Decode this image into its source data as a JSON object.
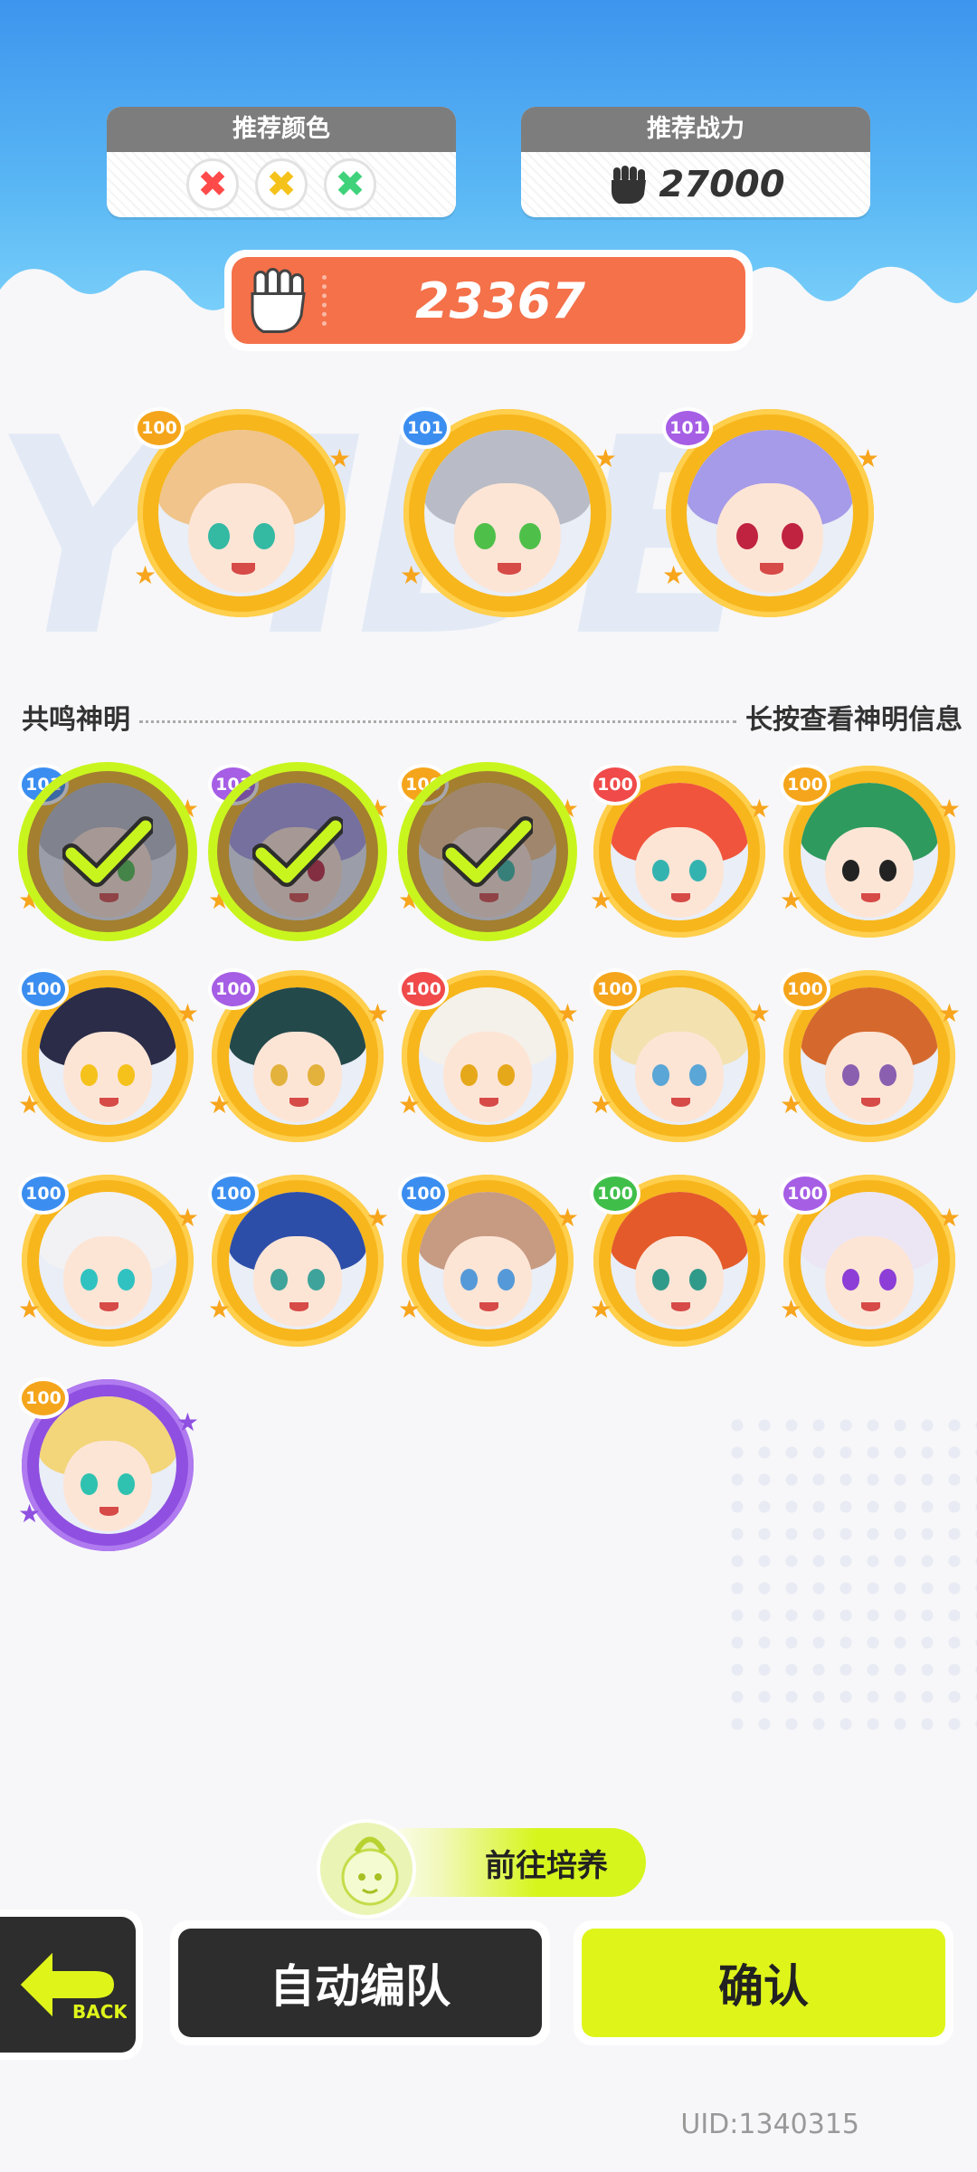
{
  "recommend": {
    "color_title": "推荐颜色",
    "colors": [
      {
        "name": "red",
        "hex": "#ff4a4a"
      },
      {
        "name": "yellow",
        "hex": "#f5c21b"
      },
      {
        "name": "green",
        "hex": "#3fd27a"
      }
    ],
    "power_title": "推荐战力",
    "power_value": "27000"
  },
  "team_power": "23367",
  "selected": [
    {
      "level": "100",
      "level_color": "#f5a51b",
      "hair": "#f0c48a",
      "eye": "#34b9a3"
    },
    {
      "level": "101",
      "level_color": "#3b8ef0",
      "hair": "#b9bcc6",
      "eye": "#4ec04a"
    },
    {
      "level": "101",
      "level_color": "#a65ee5",
      "hair": "#a69be8",
      "eye": "#c0233f"
    }
  ],
  "section": {
    "left_label": "共鸣神明",
    "right_label": "长按查看神明信息"
  },
  "roster": [
    {
      "level": "101",
      "level_color": "#3b8ef0",
      "hair": "#b9bcc6",
      "eye": "#4ec04a",
      "checked": true
    },
    {
      "level": "101",
      "level_color": "#a65ee5",
      "hair": "#a69be8",
      "eye": "#c0233f",
      "checked": true
    },
    {
      "level": "100",
      "level_color": "#f5a51b",
      "hair": "#f0c48a",
      "eye": "#34b9a3",
      "checked": true
    },
    {
      "level": "100",
      "level_color": "#f04a4a",
      "hair": "#f0543c",
      "eye": "#33b3b0",
      "checked": false
    },
    {
      "level": "100",
      "level_color": "#f5a51b",
      "hair": "#2e9a5e",
      "eye": "#222222",
      "checked": false
    },
    {
      "level": "100",
      "level_color": "#3b8ef0",
      "hair": "#2a2c48",
      "eye": "#f5c21b",
      "checked": false
    },
    {
      "level": "100",
      "level_color": "#a65ee5",
      "hair": "#24494b",
      "eye": "#e3b23c",
      "checked": false
    },
    {
      "level": "100",
      "level_color": "#f04a4a",
      "hair": "#f4f1ea",
      "eye": "#e6a81b",
      "checked": false
    },
    {
      "level": "100",
      "level_color": "#f5a51b",
      "hair": "#f3e2b0",
      "eye": "#5aa6d6",
      "checked": false
    },
    {
      "level": "100",
      "level_color": "#f5a51b",
      "hair": "#d5692d",
      "eye": "#8a5fb0",
      "checked": false
    },
    {
      "level": "100",
      "level_color": "#3b8ef0",
      "hair": "#f2f2f4",
      "eye": "#2fc2c0",
      "checked": false
    },
    {
      "level": "100",
      "level_color": "#3b8ef0",
      "hair": "#2d4ea8",
      "eye": "#3ea39a",
      "checked": false
    },
    {
      "level": "100",
      "level_color": "#3b8ef0",
      "hair": "#c79a82",
      "eye": "#5599d8",
      "checked": false
    },
    {
      "level": "100",
      "level_color": "#3fbf4a",
      "hair": "#e45a2a",
      "eye": "#2f9a8a",
      "checked": false
    },
    {
      "level": "100",
      "level_color": "#a65ee5",
      "hair": "#ece6f4",
      "eye": "#8c3ed6",
      "checked": false
    },
    {
      "level": "100",
      "level_color": "#f5a51b",
      "hair": "#f3d57a",
      "eye": "#2fc2b0",
      "checked": false,
      "purple": true
    }
  ],
  "train_button": "前往培养",
  "back_label": "BACK",
  "auto_button": "自动编队",
  "confirm_button": "确认",
  "uid": "UID:1340315",
  "bg_text": "Y IDE"
}
